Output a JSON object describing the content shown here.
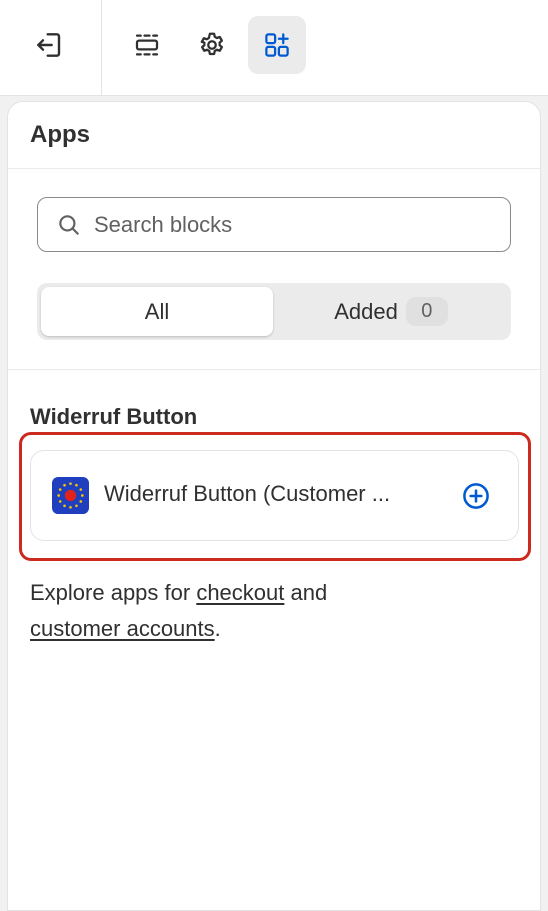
{
  "toolbar": {
    "buttons": [
      {
        "name": "exit",
        "icon": "exit-icon"
      },
      {
        "name": "sections",
        "icon": "sections-icon"
      },
      {
        "name": "settings",
        "icon": "gear-icon"
      },
      {
        "name": "apps",
        "icon": "apps-add-icon",
        "active": true
      }
    ]
  },
  "panel": {
    "title": "Apps",
    "search": {
      "placeholder": "Search blocks",
      "value": ""
    },
    "filter": {
      "all_label": "All",
      "added_label": "Added",
      "added_count": "0",
      "selected": "All"
    },
    "group": {
      "title": "Widerruf Button",
      "blocks": [
        {
          "label": "Widerruf Button (Customer ...",
          "icon": "eu-stars-app-icon"
        }
      ]
    },
    "explore": {
      "prefix": "Explore apps for ",
      "link1": "checkout",
      "middle": " and",
      "link2": "customer accounts",
      "suffix": "."
    }
  },
  "colors": {
    "accent": "#005bd3",
    "highlight": "#cc2a1f",
    "app_icon_bg": "#1f3fbf",
    "app_icon_dot": "#e0241b",
    "app_icon_stars": "#f5c400"
  }
}
